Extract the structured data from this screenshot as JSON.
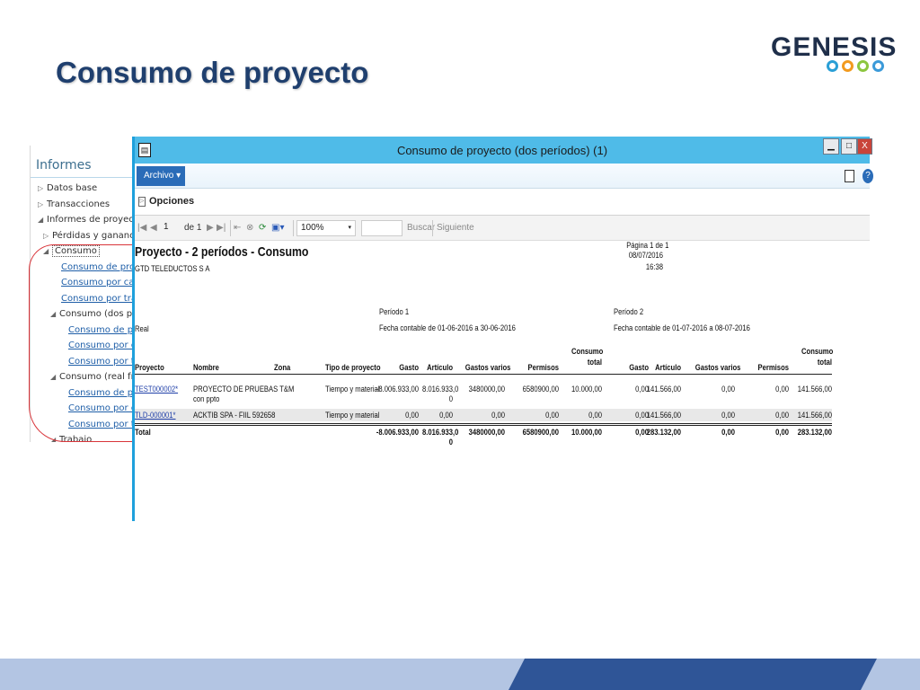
{
  "slide": {
    "title": "Consumo de proyecto",
    "logo_text": "GENESIS"
  },
  "nav": {
    "title": "Informes",
    "items": [
      {
        "label": "Datos base",
        "indent": 0,
        "expanded": false,
        "kind": "node"
      },
      {
        "label": "Transacciones",
        "indent": 0,
        "expanded": false,
        "kind": "node"
      },
      {
        "label": "Informes de proyect",
        "indent": 0,
        "expanded": true,
        "kind": "node"
      },
      {
        "label": "Pérdidas y gananci",
        "indent": 1,
        "expanded": false,
        "kind": "node"
      },
      {
        "label": "Consumo",
        "indent": 1,
        "expanded": true,
        "kind": "node",
        "selected": true
      },
      {
        "label": "Consumo de proy",
        "indent": 3,
        "kind": "link"
      },
      {
        "label": "Consumo por cat",
        "indent": 3,
        "kind": "link"
      },
      {
        "label": "Consumo por tra",
        "indent": 3,
        "kind": "link"
      },
      {
        "label": "Consumo (dos pe",
        "indent": 2,
        "expanded": true,
        "kind": "node"
      },
      {
        "label": "Consumo de pr",
        "indent": 4,
        "kind": "link"
      },
      {
        "label": "Consumo por c",
        "indent": 4,
        "kind": "link"
      },
      {
        "label": "Consumo por tr",
        "indent": 4,
        "kind": "link"
      },
      {
        "label": "Consumo (real fr",
        "indent": 2,
        "expanded": true,
        "kind": "node"
      },
      {
        "label": "Consumo de pr",
        "indent": 4,
        "kind": "link"
      },
      {
        "label": "Consumo por c",
        "indent": 4,
        "kind": "link"
      },
      {
        "label": "Consumo por tr",
        "indent": 4,
        "kind": "link"
      },
      {
        "label": "Trabajo",
        "indent": 2,
        "expanded": true,
        "kind": "node"
      }
    ]
  },
  "window": {
    "title": "Consumo de proyecto (dos períodos) (1)",
    "buttons": {
      "min": "▁",
      "max": "□",
      "close": "X"
    },
    "archivo_label": "Archivo",
    "opciones_label": "Opciones",
    "toolbar": {
      "page": "1",
      "of_label": "de 1",
      "zoom": "100%",
      "search_label": "Buscar",
      "next_label": "Siguiente"
    }
  },
  "report": {
    "title": "Proyecto - 2 períodos - Consumo",
    "company": "GTD TELEDUCTOS S A",
    "page_info": "Página 1 de 1",
    "date": "08/07/2016",
    "time": "16:38",
    "real_label": "Real",
    "period1": {
      "label": "Período 1",
      "range": "Fecha contable de 01-06-2016 a 30-06-2016"
    },
    "period2": {
      "label": "Período 2",
      "range": "Fecha contable de 01-07-2016 a 08-07-2016"
    },
    "columns": {
      "proyecto": "Proyecto",
      "nombre": "Nombre",
      "zona": "Zona",
      "tipo": "Tipo de proyecto",
      "gasto": "Gasto",
      "articulo": "Artículo",
      "gastos_varios": "Gastos varios",
      "permisos": "Permisos",
      "consumo_total_1": "Consumo",
      "consumo_total_2": "total"
    },
    "rows": [
      {
        "proyecto": "TEST000002*",
        "nombre_1": "PROYECTO DE PRUEBAS T&M",
        "nombre_2": "con ppto",
        "tipo": "Tiempo y material",
        "p1_gasto": "-8.006.933,00",
        "p1_articulo_1": "8.016.933,0",
        "p1_articulo_2": "0",
        "p1_gastos_varios": "3480000,00",
        "p1_permisos": "6580900,00",
        "p1_total": "10.000,00",
        "p2_gasto": "0,00",
        "p2_articulo": "141.566,00",
        "p2_gastos_varios": "0,00",
        "p2_permisos": "0,00",
        "p2_total": "141.566,00"
      },
      {
        "proyecto": "TLD-000001*",
        "nombre_1": "ACKTIB SPA - FIIL 592658",
        "nombre_2": "",
        "tipo": "Tiempo y material",
        "p1_gasto": "0,00",
        "p1_articulo_1": "0,00",
        "p1_articulo_2": "",
        "p1_gastos_varios": "0,00",
        "p1_permisos": "0,00",
        "p1_total": "0,00",
        "p2_gasto": "0,00",
        "p2_articulo": "141.566,00",
        "p2_gastos_varios": "0,00",
        "p2_permisos": "0,00",
        "p2_total": "141.566,00"
      }
    ],
    "total": {
      "label": "Total",
      "p1_gasto": "-8.006.933,00",
      "p1_articulo_1": "8.016.933,0",
      "p1_articulo_2": "0",
      "p1_gastos_varios": "3480000,00",
      "p1_permisos": "6580900,00",
      "p1_total": "10.000,00",
      "p2_gasto": "0,00",
      "p2_articulo": "283.132,00",
      "p2_gastos_varios": "0,00",
      "p2_permisos": "0,00",
      "p2_total": "283.132,00"
    }
  }
}
